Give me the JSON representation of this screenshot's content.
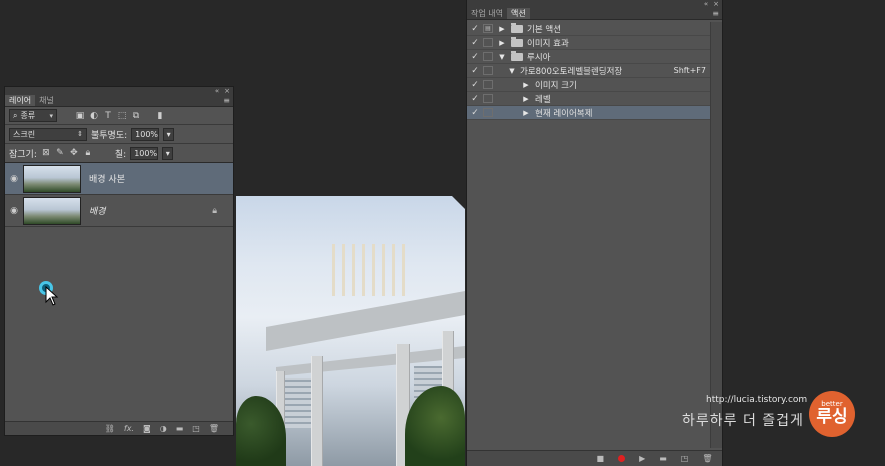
{
  "layers_panel": {
    "tabs": [
      "레이어",
      "채널"
    ],
    "filter_kind": "종류",
    "blend_mode": "스크린",
    "opacity_label": "불투명도:",
    "opacity_value": "100%",
    "lock_label": "잠그기:",
    "fill_label": "칠:",
    "fill_value": "100%",
    "layers": [
      {
        "name": "배경 사본",
        "selected": true
      },
      {
        "name": "배경",
        "selected": false,
        "locked": true
      }
    ],
    "bottom_icons": [
      "link-icon",
      "fx-icon",
      "mask-icon",
      "adjustment-icon",
      "folder-icon",
      "new-layer-icon",
      "trash-icon"
    ]
  },
  "actions_panel": {
    "tabs": [
      "작업 내역",
      "액션"
    ],
    "rows": [
      {
        "label": "기본 액션",
        "type": "set",
        "expanded": false
      },
      {
        "label": "이미지 효과",
        "type": "set",
        "expanded": false
      },
      {
        "label": "루시아",
        "type": "set",
        "expanded": true
      },
      {
        "label": "가로800오토레벨블렌딩저장",
        "type": "action",
        "expanded": true,
        "shortcut": "Shft+F7"
      },
      {
        "label": "이미지 크기",
        "type": "step"
      },
      {
        "label": "레벨",
        "type": "step"
      },
      {
        "label": "현재 레이어복제",
        "type": "step",
        "selected": true
      }
    ],
    "bottom_icons": [
      "stop-icon",
      "record-icon",
      "play-icon",
      "folder-icon",
      "new-action-icon",
      "trash-icon"
    ]
  },
  "watermark": {
    "url": "http://lucia.tistory.com",
    "tagline": "하루하루 더 즐겁게",
    "logo_small": "better",
    "logo_big": "루싱"
  },
  "colors": {
    "panel_bg": "#535353",
    "selection": "#5f6b79",
    "record": "#e02020",
    "logo": "#e0622f"
  }
}
